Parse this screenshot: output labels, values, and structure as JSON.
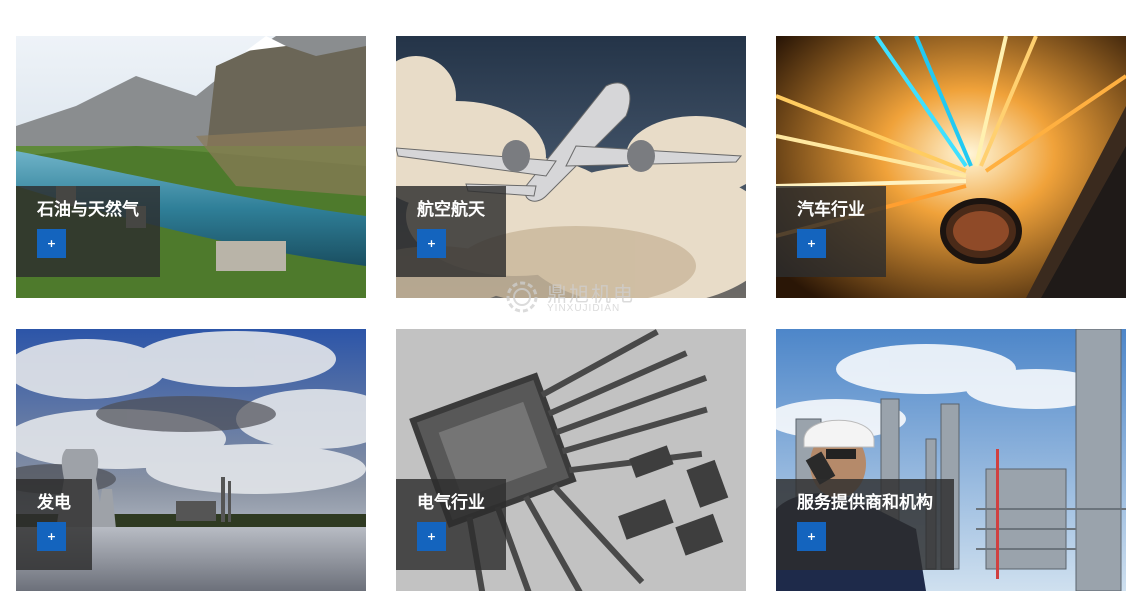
{
  "industries": [
    {
      "label": "石油与天然气",
      "button": "+"
    },
    {
      "label": "航空航天",
      "button": "+"
    },
    {
      "label": "汽车行业",
      "button": "+"
    },
    {
      "label": "发电",
      "button": "+"
    },
    {
      "label": "电气行业",
      "button": "+"
    },
    {
      "label": "服务提供商和机构",
      "button": "+"
    }
  ],
  "watermark": {
    "cn": "鼎旭机电",
    "en": "YINXUJIDIAN"
  },
  "colors": {
    "accent": "#1464be",
    "label_bg": "#2d2d2d"
  }
}
